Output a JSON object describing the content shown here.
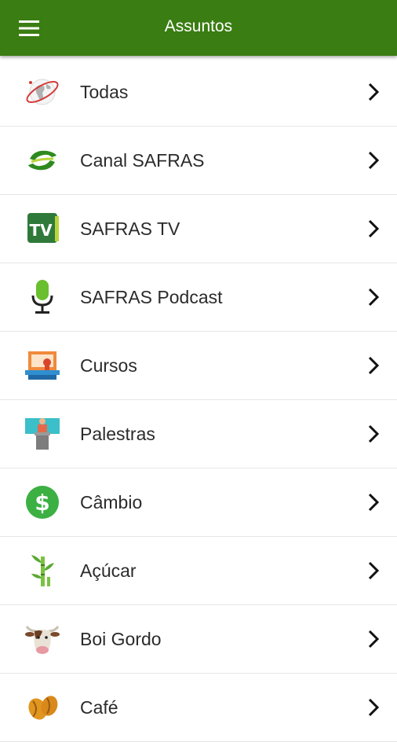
{
  "appbar": {
    "title": "Assuntos",
    "menu_icon": "hamburger-menu-icon"
  },
  "colors": {
    "appbar": "#3a7d12",
    "text": "#2b2b2b",
    "divider": "#e6e6e6"
  },
  "items": [
    {
      "label": "Todas",
      "icon": "globe-icon"
    },
    {
      "label": "Canal SAFRAS",
      "icon": "safras-logo-icon"
    },
    {
      "label": "SAFRAS TV",
      "icon": "tv-icon"
    },
    {
      "label": "SAFRAS Podcast",
      "icon": "microphone-icon"
    },
    {
      "label": "Cursos",
      "icon": "certificate-icon"
    },
    {
      "label": "Palestras",
      "icon": "lecture-podium-icon"
    },
    {
      "label": "Câmbio",
      "icon": "dollar-icon"
    },
    {
      "label": "Açúcar",
      "icon": "sugarcane-icon"
    },
    {
      "label": "Boi Gordo",
      "icon": "cow-icon"
    },
    {
      "label": "Café",
      "icon": "coffee-bean-icon"
    }
  ]
}
